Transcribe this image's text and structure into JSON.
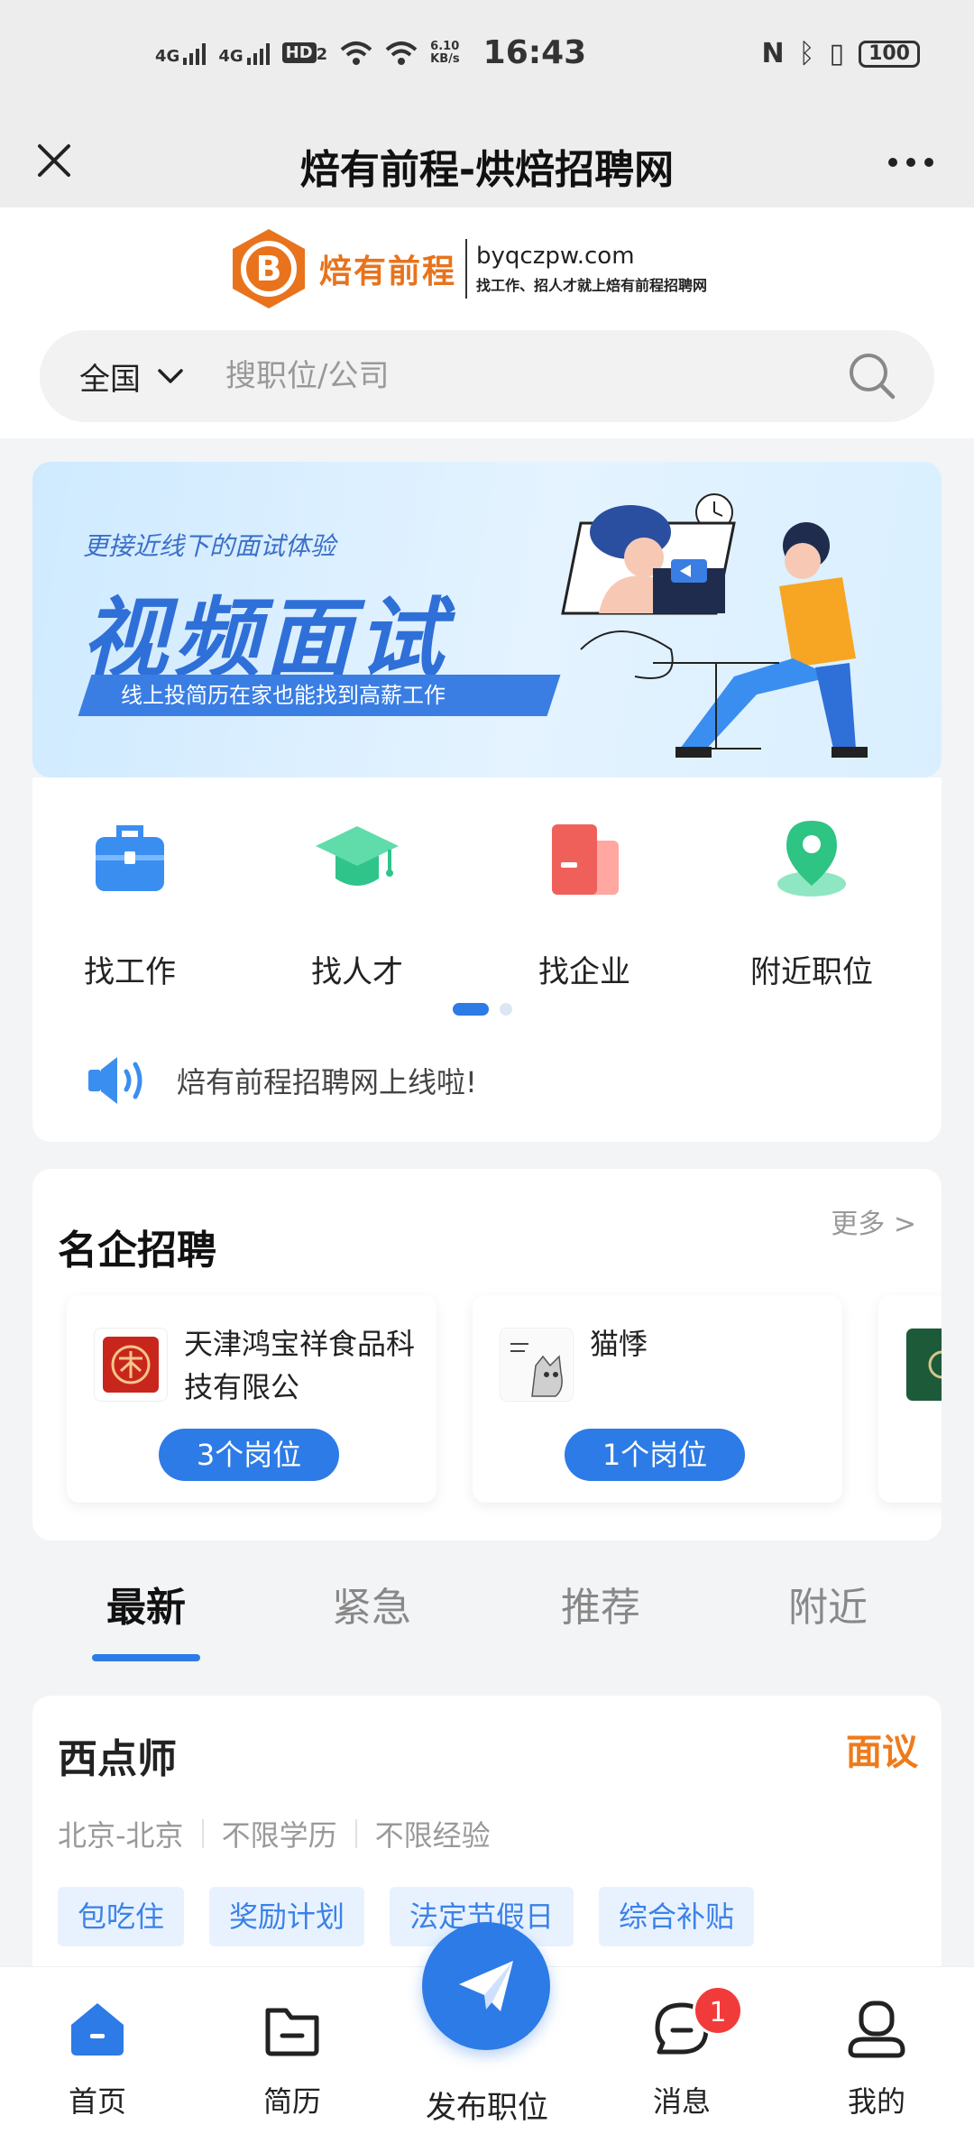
{
  "status_bar": {
    "net1": "4G",
    "net2": "4G",
    "hd": "HD",
    "hd_sub": "2",
    "speed": "6.10",
    "speed_unit": "KB/s",
    "time": "16:43",
    "battery": "100"
  },
  "titlebar": {
    "title": "焙有前程-烘焙招聘网"
  },
  "header": {
    "logo_cn": "焙有前程",
    "logo_domain": "byqczpw.com",
    "logo_slogan": "找工作、招人才就上焙有前程招聘网"
  },
  "search": {
    "region": "全国",
    "placeholder": "搜职位/公司"
  },
  "banner": {
    "subtitle": "更接近线下的面试体验",
    "title": "视频面试",
    "strip": "线上投简历在家也能找到高薪工作"
  },
  "quick_nav": [
    {
      "label": "找工作",
      "icon": "briefcase-icon",
      "color": "#3a8ef0"
    },
    {
      "label": "找人才",
      "icon": "graduation-cap-icon",
      "color": "#2fc48a"
    },
    {
      "label": "找企业",
      "icon": "building-icon",
      "color": "#f0605a"
    },
    {
      "label": "附近职位",
      "icon": "location-pin-icon",
      "color": "#2ec483"
    }
  ],
  "notice": {
    "text": "焙有前程招聘网上线啦!"
  },
  "famous": {
    "title": "名企招聘",
    "more": "更多 >",
    "companies": [
      {
        "name": "天津鸿宝祥食品科技有限公",
        "jobs": "3个岗位"
      },
      {
        "name": "猫悸",
        "jobs": "1个岗位"
      }
    ]
  },
  "tabs": [
    "最新",
    "紧急",
    "推荐",
    "附近"
  ],
  "job": {
    "title": "西点师",
    "salary": "面议",
    "location": "北京-北京",
    "education": "不限学历",
    "experience": "不限经验",
    "tags": [
      "包吃住",
      "奖励计划",
      "法定节假日",
      "综合补贴"
    ]
  },
  "bottom_nav": {
    "home": "首页",
    "resume": "简历",
    "publish": "发布职位",
    "messages": "消息",
    "messages_badge": "1",
    "mine": "我的"
  },
  "colors": {
    "accent": "#2d7be6",
    "salary": "#f07a1a",
    "brand_orange": "#e8731c"
  }
}
